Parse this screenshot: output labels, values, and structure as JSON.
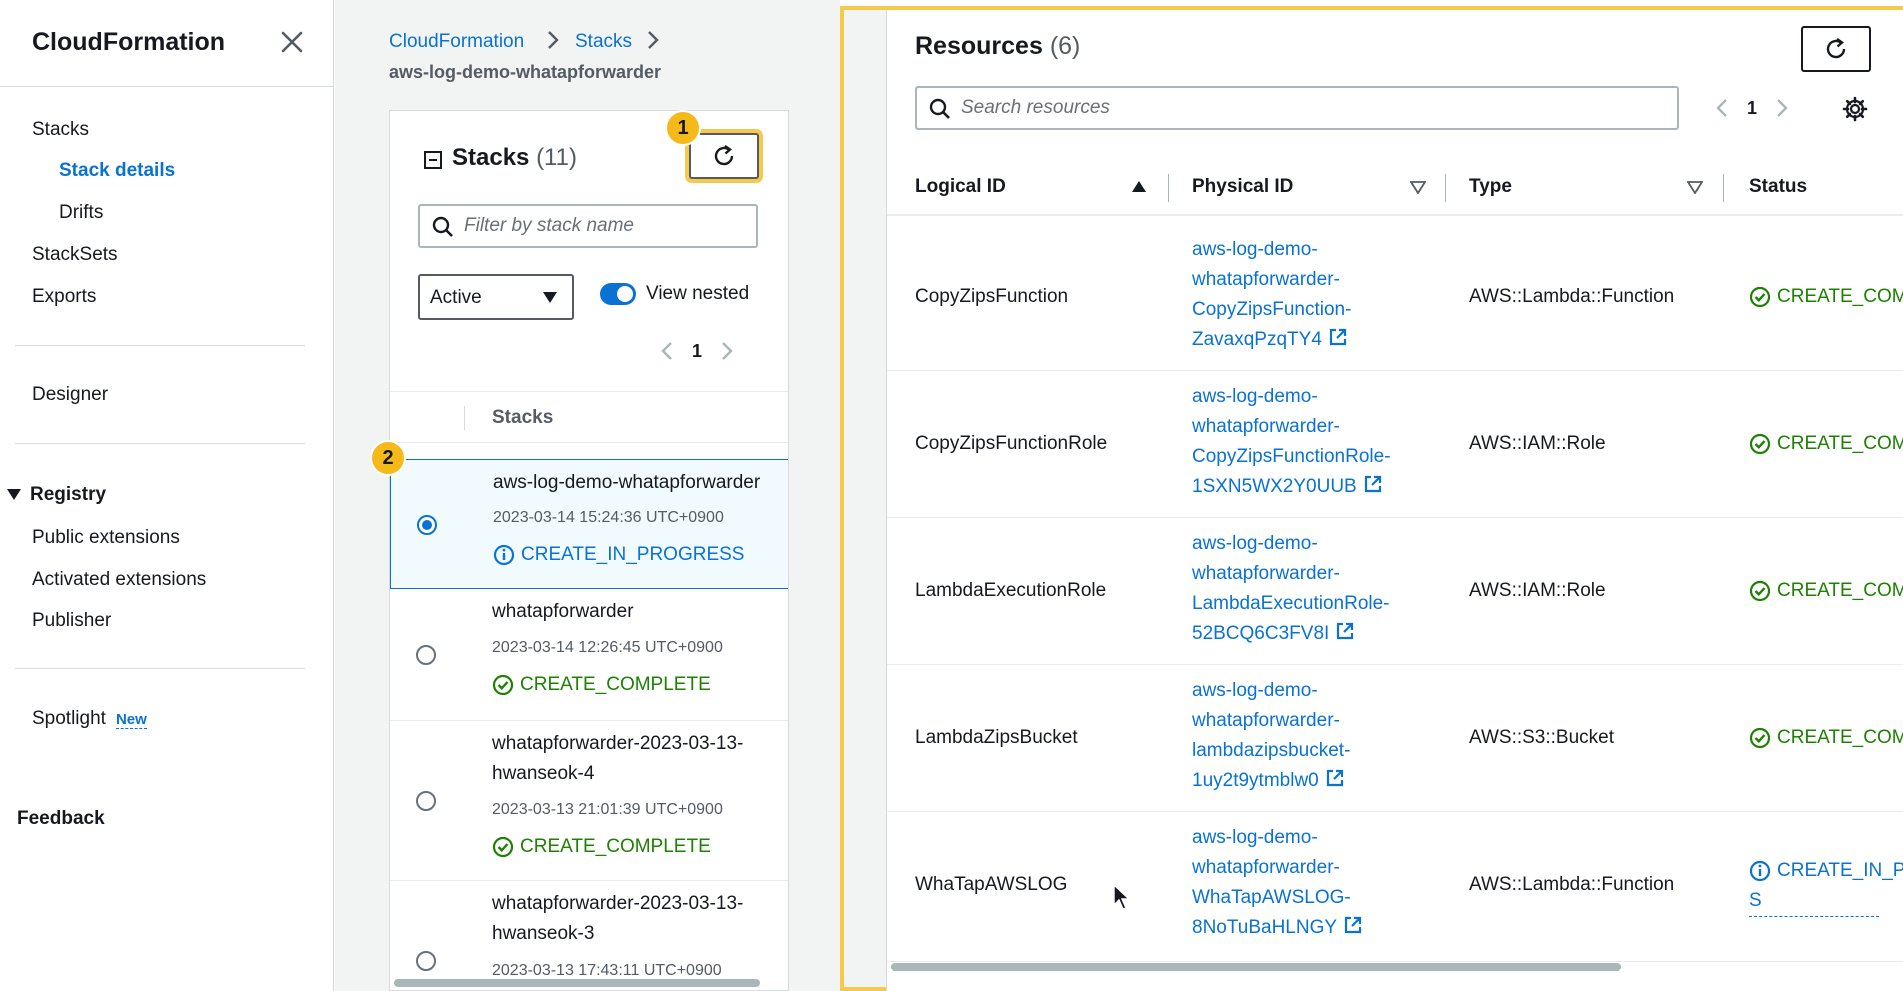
{
  "sidebar": {
    "title": "CloudFormation",
    "items": [
      {
        "label": "Stacks"
      },
      {
        "label": "Stack details"
      },
      {
        "label": "Drifts"
      },
      {
        "label": "StackSets"
      },
      {
        "label": "Exports"
      },
      {
        "label": "Designer"
      },
      {
        "label": "Registry"
      },
      {
        "label": "Public extensions"
      },
      {
        "label": "Activated extensions"
      },
      {
        "label": "Publisher"
      },
      {
        "label": "Spotlight",
        "badge": "New"
      },
      {
        "label": "Feedback"
      }
    ]
  },
  "breadcrumb": {
    "items": [
      "CloudFormation",
      "Stacks"
    ],
    "current": "aws-log-demo-whatapforwarder"
  },
  "stacks_panel": {
    "title": "Stacks",
    "count": "(11)",
    "filter_placeholder": "Filter by stack name",
    "status_filter": "Active",
    "view_nested_label": "View nested",
    "page": "1",
    "column_header": "Stacks",
    "callouts": [
      "1",
      "2"
    ],
    "rows": [
      {
        "name": "aws-log-demo-whatapforwarder",
        "time": "2023-03-14 15:24:36 UTC+0900",
        "status": "CREATE_IN_PROGRESS"
      },
      {
        "name": "whatapforwarder",
        "time": "2023-03-14 12:26:45 UTC+0900",
        "status": "CREATE_COMPLETE"
      },
      {
        "name": "whatapforwarder-2023-03-13-hwanseok-4",
        "time": "2023-03-13 21:01:39 UTC+0900",
        "status": "CREATE_COMPLETE"
      },
      {
        "name": "whatapforwarder-2023-03-13-hwanseok-3",
        "time": "2023-03-13 17:43:11 UTC+0900",
        "status": ""
      }
    ]
  },
  "resources": {
    "title": "Resources",
    "count": "(6)",
    "search_placeholder": "Search resources",
    "page": "1",
    "columns": [
      "Logical ID",
      "Physical ID",
      "Type",
      "Status"
    ],
    "rows": [
      {
        "logical_id": "CopyZipsFunction",
        "physical_id": [
          "aws-log-demo-",
          "whatapforwarder-",
          "CopyZipsFunction-",
          "ZavaxqPzqTY4"
        ],
        "type": "AWS::Lambda::Function",
        "status": "CREATE_COMP"
      },
      {
        "logical_id": "CopyZipsFunctionRole",
        "physical_id": [
          "aws-log-demo-",
          "whatapforwarder-",
          "CopyZipsFunctionRole-",
          "1SXN5WX2Y0UUB"
        ],
        "type": "AWS::IAM::Role",
        "status": "CREATE_COMP"
      },
      {
        "logical_id": "LambdaExecutionRole",
        "physical_id": [
          "aws-log-demo-",
          "whatapforwarder-",
          "LambdaExecutionRole-",
          "52BCQ6C3FV8I"
        ],
        "type": "AWS::IAM::Role",
        "status": "CREATE_COMP"
      },
      {
        "logical_id": "LambdaZipsBucket",
        "physical_id": [
          "aws-log-demo-",
          "whatapforwarder-",
          "lambdazipsbucket-",
          "1uy2t9ytmblw0"
        ],
        "type": "AWS::S3::Bucket",
        "status": "CREATE_COMP"
      },
      {
        "logical_id": "WhaTapAWSLOG",
        "physical_id": [
          "aws-log-demo-",
          "whatapforwarder-",
          "WhaTapAWSLOG-",
          "8NoTuBaHLNGY"
        ],
        "type": "AWS::Lambda::Function",
        "status": "CREATE_IN_PR",
        "status_wrap": "S"
      }
    ]
  },
  "colors": {
    "accent": "#0972d3",
    "success": "#1d8102",
    "highlight": "#f6c84b",
    "callout": "#f6b91a"
  }
}
